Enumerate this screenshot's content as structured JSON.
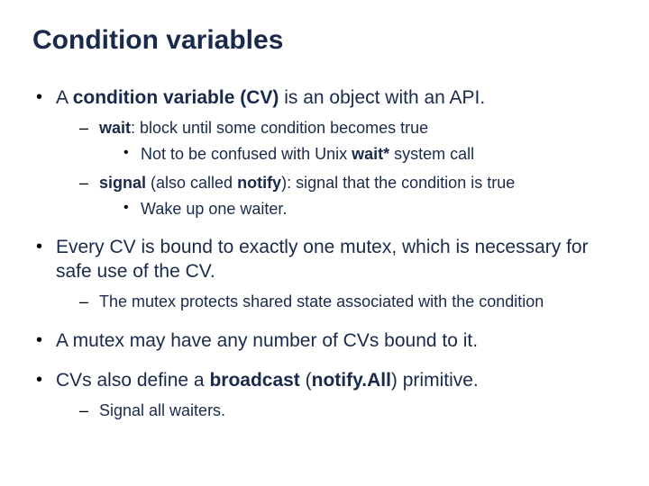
{
  "title": "Condition variables",
  "bullets": {
    "b1": {
      "pre": "A ",
      "bold": "condition variable (CV)",
      "post": " is an object with an API.",
      "sub": {
        "s1": {
          "bold": "wait",
          "post": ": block until some condition becomes true",
          "sub": {
            "t1": {
              "pre": "Not to be confused with Unix ",
              "bold": "wait*",
              "post": " system call"
            }
          }
        },
        "s2": {
          "bold": "signal",
          "mid": " (also called ",
          "bold2": "notify",
          "post": "): signal that the condition is true",
          "sub": {
            "t1": {
              "text": "Wake up one waiter."
            }
          }
        }
      }
    },
    "b2": {
      "text": "Every CV is bound to exactly one mutex, which is necessary for safe use of the CV.",
      "sub": {
        "s1": {
          "text": "The mutex protects shared state associated with the condition"
        }
      }
    },
    "b3": {
      "text": "A mutex may have any number of CVs bound to it."
    },
    "b4": {
      "pre": "CVs also define a ",
      "bold": "broadcast",
      "mid": " (",
      "bold2": "notify.All",
      "post": ") primitive.",
      "sub": {
        "s1": {
          "text": "Signal all waiters."
        }
      }
    }
  }
}
